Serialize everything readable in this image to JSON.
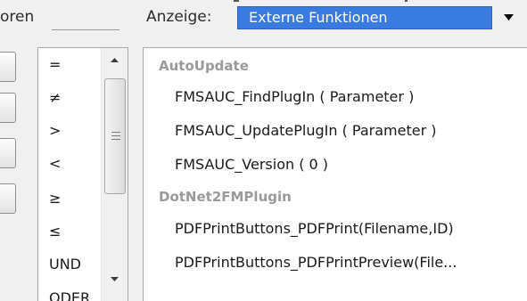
{
  "header": {
    "left_label": "oren",
    "anzeige_label": "Anzeige:",
    "anzeige_value": "Externe Funktionen",
    "anzeige_arrow_icon": "triangle-down",
    "selected_color": "#3a7be0"
  },
  "operators": [
    "=",
    "≠",
    ">",
    "<",
    "≥",
    "≤",
    "UND",
    "ODER"
  ],
  "functions": {
    "groups": [
      {
        "name": "AutoUpdate",
        "items": [
          "FMSAUC_FindPlugIn ( Parameter )",
          "FMSAUC_UpdatePlugIn ( Parameter )",
          "FMSAUC_Version ( 0 )"
        ]
      },
      {
        "name": "DotNet2FMPlugin",
        "items": [
          "PDFPrintButtons_PDFPrint(Filename,ID)",
          "PDFPrintButtons_PDFPrintPreview(File..."
        ]
      }
    ]
  }
}
